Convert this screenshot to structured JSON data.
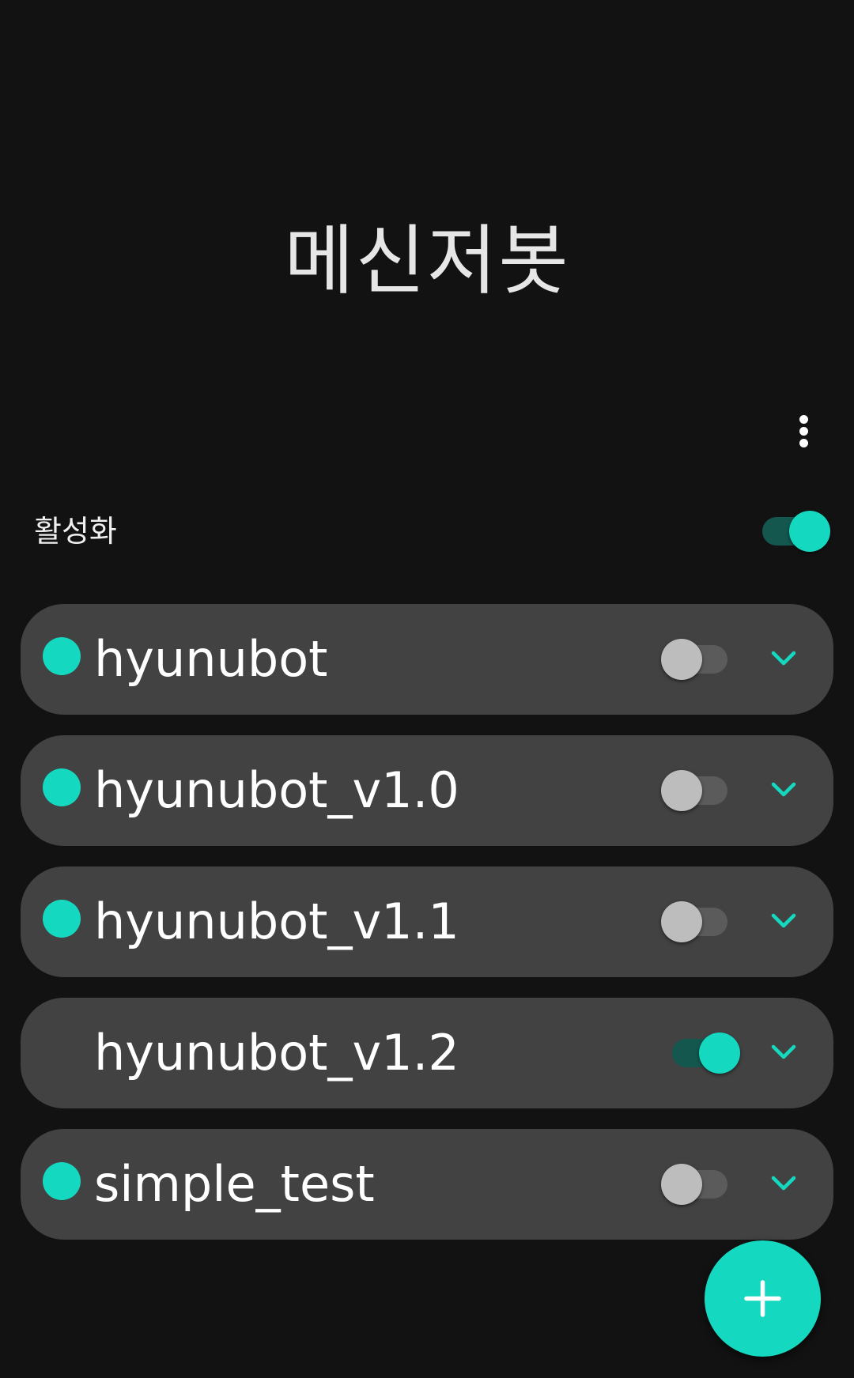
{
  "app": {
    "title": "메신저봇"
  },
  "toolbar": {
    "more_icon": "more-vert-icon"
  },
  "master": {
    "label": "활성화",
    "enabled": true
  },
  "bots": [
    {
      "name": "hyunubot",
      "status_dot": true,
      "enabled": false,
      "expand_icon": "chevron-down-icon"
    },
    {
      "name": "hyunubot_v1.0",
      "status_dot": true,
      "enabled": false,
      "expand_icon": "chevron-down-icon"
    },
    {
      "name": "hyunubot_v1.1",
      "status_dot": true,
      "enabled": false,
      "expand_icon": "chevron-down-icon"
    },
    {
      "name": "hyunubot_v1.2",
      "status_dot": false,
      "enabled": true,
      "expand_icon": "chevron-down-icon"
    },
    {
      "name": "simple_test",
      "status_dot": true,
      "enabled": false,
      "expand_icon": "chevron-down-icon"
    }
  ],
  "fab": {
    "icon": "plus-icon"
  },
  "colors": {
    "accent": "#14d9c0",
    "accent_track": "#14574f",
    "background": "#121212",
    "card": "#424242",
    "switch_off_thumb": "#bdbdbd",
    "switch_off_track": "#5b5b5b"
  }
}
